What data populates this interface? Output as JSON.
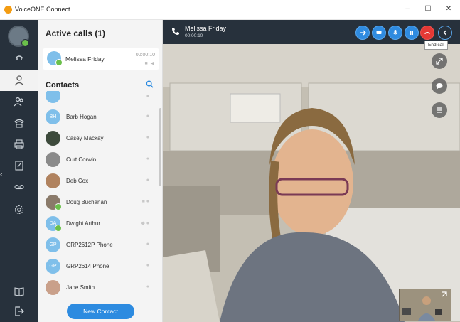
{
  "window": {
    "title": "VoiceONE Connect",
    "minimize": "–",
    "maximize": "☐",
    "close": "✕"
  },
  "leftnav": {
    "items": [
      {
        "name": "calls-icon"
      },
      {
        "name": "contacts-icon"
      },
      {
        "name": "groups-icon"
      },
      {
        "name": "phone-icon"
      },
      {
        "name": "fax-icon"
      },
      {
        "name": "notes-icon"
      },
      {
        "name": "voicemail-icon"
      },
      {
        "name": "settings-icon"
      },
      {
        "name": "book-icon"
      },
      {
        "name": "logout-icon"
      }
    ],
    "collapse": "‹"
  },
  "active_calls": {
    "title": "Active calls (1)",
    "call": {
      "name": "Melissa Friday",
      "duration": "00:00:10",
      "icons": "■ ◀"
    }
  },
  "contacts": {
    "title": "Contacts",
    "items": [
      {
        "name": "Barb Hogan",
        "initials": "BH",
        "color": "#7fbfea",
        "icons": "●"
      },
      {
        "name": "Casey Mackay",
        "initials": "",
        "color": "#3d4a3c",
        "icons": "●"
      },
      {
        "name": "Curt Corwin",
        "initials": "",
        "color": "#8a8a8a",
        "icons": "●"
      },
      {
        "name": "Deb Cox",
        "initials": "",
        "color": "#b0825e",
        "icons": "●"
      },
      {
        "name": "Doug Buchanan",
        "initials": "",
        "color": "#8a7a6a",
        "icons": "■ ●"
      },
      {
        "name": "Dwight Arthur",
        "initials": "DA",
        "color": "#7fbfea",
        "icons": "◆ ●"
      },
      {
        "name": "GRP2612P Phone",
        "initials": "GP",
        "color": "#7fbfea",
        "icons": "●"
      },
      {
        "name": "GRP2614 Phone",
        "initials": "GP",
        "color": "#7fbfea",
        "icons": "●"
      },
      {
        "name": "Jane Smith",
        "initials": "",
        "color": "#c9a08a",
        "icons": "●"
      }
    ],
    "new_contact_label": "New Contact"
  },
  "call_view": {
    "caller": "Melissa Friday",
    "duration": "00:00:10",
    "end_call_tooltip": "End call",
    "accent": "#2f8be0",
    "end_color": "#e53935"
  }
}
